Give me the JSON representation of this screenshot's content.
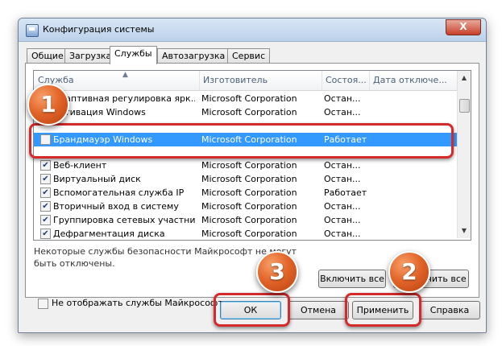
{
  "window": {
    "title": "Конфигурация системы",
    "close_label": "X"
  },
  "tabs": [
    {
      "label": "Общие"
    },
    {
      "label": "Загрузка"
    },
    {
      "label": "Службы",
      "active": true
    },
    {
      "label": "Автозагрузка"
    },
    {
      "label": "Сервис"
    }
  ],
  "columns": {
    "service": "Служба",
    "manufacturer": "Изготовитель",
    "status": "Состоя...",
    "disabled_date": "Дата отключе..."
  },
  "services": [
    {
      "name": "Адаптивная регулировка ярк...",
      "manufacturer": "Microsoft Corporation",
      "status": "Остан...",
      "checked": true
    },
    {
      "name": "Активация Windows",
      "manufacturer": "Microsoft Corporation",
      "status": "Остан...",
      "checked": true
    },
    {
      "name": "Брандмауэр Windows",
      "manufacturer": "Microsoft Corporation",
      "status": "Работает",
      "checked": false,
      "selected": true
    },
    {
      "name": "Веб-клиент",
      "manufacturer": "Microsoft Corporation",
      "status": "Остан...",
      "checked": true
    },
    {
      "name": "Виртуальный диск",
      "manufacturer": "Microsoft Corporation",
      "status": "Остан...",
      "checked": true
    },
    {
      "name": "Вспомогательная служба IP",
      "manufacturer": "Microsoft Corporation",
      "status": "Работает",
      "checked": true
    },
    {
      "name": "Вторичный вход в систему",
      "manufacturer": "Microsoft Corporation",
      "status": "Остан...",
      "checked": true
    },
    {
      "name": "Группировка сетевых участни...",
      "manufacturer": "Microsoft Corporation",
      "status": "Остан...",
      "checked": true
    },
    {
      "name": "Дефрагментация диска",
      "manufacturer": "Microsoft Corporation",
      "status": "Остан...",
      "checked": true
    }
  ],
  "note": "Некоторые службы безопасности Майкрософт не могут быть отключены.",
  "buttons": {
    "enable_all": "Включить все",
    "disable_all": "Отключить все",
    "ok": "ОК",
    "cancel": "Отмена",
    "apply": "Применить",
    "help": "Справка"
  },
  "hide_ms_label": "Не отображать службы Майкрософт",
  "annotations": [
    "1",
    "2",
    "3"
  ],
  "colors": {
    "selection": "#3399ff",
    "highlight": "#d42a2a",
    "badge": "#e3662a"
  }
}
